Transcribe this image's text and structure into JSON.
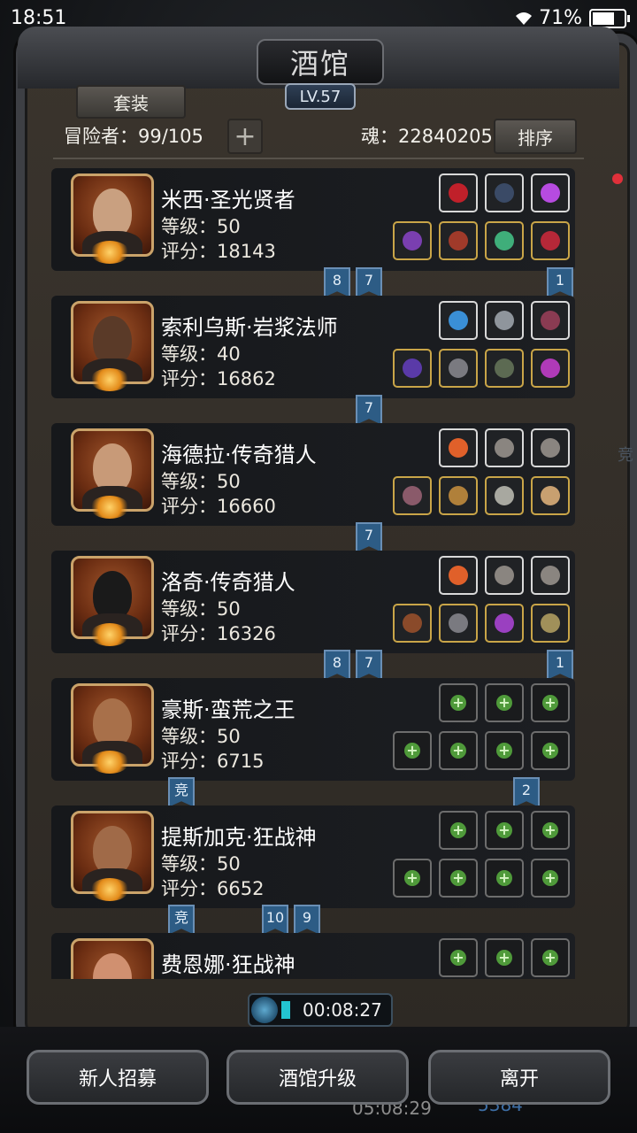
{
  "status": {
    "time": "18:51",
    "battery": "71%",
    "battery_level": 0.71
  },
  "header": {
    "title": "酒馆",
    "level": "LV.57",
    "set_label": "套装",
    "adventurers": "冒险者：99/105",
    "soul": "魂：22840205",
    "sort_label": "排序"
  },
  "heroes": [
    {
      "name": "米西·圣光贤者",
      "level": "等级：50",
      "score": "评分：18143",
      "top_slots": [
        "ruby-heart",
        "dark-bow",
        "purple-gem"
      ],
      "bottom_slots": [
        "purple-staff",
        "red-armor",
        "green-ring",
        "crimson-amulet"
      ],
      "ribbons": [
        "8",
        "7",
        "1"
      ]
    },
    {
      "name": "索利乌斯·岩浆法师",
      "level": "等级：40",
      "score": "评分：16862",
      "top_slots": [
        "blue-orb",
        "mask",
        "dark-cloak"
      ],
      "bottom_slots": [
        "violet-staff",
        "chest-armor",
        "helmet",
        "magenta-gauntlet"
      ],
      "ribbons": [
        "7"
      ]
    },
    {
      "name": "海德拉·传奇猎人",
      "level": "等级：50",
      "score": "评分：16660",
      "top_slots": [
        "fire-rune",
        "feather",
        "feather"
      ],
      "bottom_slots": [
        "dagger",
        "gold-armor",
        "gold-helm",
        "gold-bracer"
      ],
      "ribbons": [
        "7"
      ]
    },
    {
      "name": "洛奇·传奇猎人",
      "level": "等级：50",
      "score": "评分：16326",
      "top_slots": [
        "fire-rune",
        "feather",
        "feather"
      ],
      "bottom_slots": [
        "pistol",
        "chest-armor",
        "purple-helm",
        "beast-pet"
      ],
      "ribbons": [
        "8",
        "7",
        "1"
      ]
    },
    {
      "name": "豪斯·蛮荒之王",
      "level": "等级：50",
      "score": "评分：6715",
      "top_slots": [
        "empty",
        "empty",
        "empty"
      ],
      "bottom_slots": [
        "empty",
        "empty",
        "empty",
        "empty"
      ],
      "ribbons": [
        "竞",
        "2"
      ]
    },
    {
      "name": "提斯加克·狂战神",
      "level": "等级：50",
      "score": "评分：6652",
      "top_slots": [
        "empty",
        "empty",
        "empty"
      ],
      "bottom_slots": [
        "empty",
        "empty",
        "empty",
        "empty"
      ],
      "ribbons": [
        "竞",
        "10",
        "9"
      ]
    },
    {
      "name": "费恩娜·狂战神",
      "level": "",
      "score": "",
      "top_slots": [
        "empty",
        "empty",
        "empty"
      ],
      "bottom_slots": [],
      "ribbons": []
    }
  ],
  "timer": "00:08:27",
  "buttons": {
    "recruit": "新人招募",
    "upgrade": "酒馆升级",
    "leave": "离开"
  },
  "background": {
    "timer2": "05:08:29",
    "count": "5384",
    "side": "竞"
  },
  "colors": {
    "ribbon": "#2d5c85",
    "gold_border": "#c9a548",
    "plus_green": "#4f9a3a"
  }
}
